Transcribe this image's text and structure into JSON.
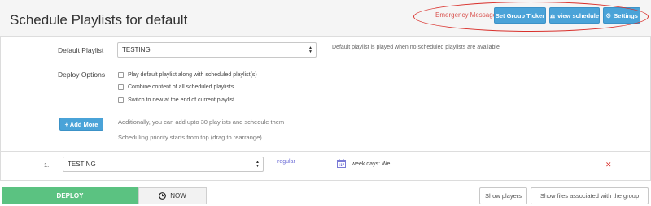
{
  "header": {
    "title": "Schedule Playlists for default",
    "emergency_message": "Emergency Message",
    "set_group_ticker": "Set Group Ticker",
    "view_schedule": "view schedule",
    "settings": "Settings"
  },
  "form": {
    "default_playlist_label": "Default Playlist",
    "default_playlist_value": "TESTING",
    "default_playlist_hint": "Default playlist is played when no scheduled playlists are available",
    "deploy_options_label": "Deploy Options",
    "options": [
      {
        "label": "Play default playlist along with scheduled playlist(s)",
        "checked": false
      },
      {
        "label": "Combine content of all scheduled playlists",
        "checked": false
      },
      {
        "label": "Switch to new at the end of current playlist",
        "checked": false
      }
    ],
    "add_more": "+ Add More",
    "info_line_1": "Additionally, you can add upto 30 playlists and schedule them",
    "info_line_2": "Scheduling priority starts from top (drag to rearrange)"
  },
  "schedule_rows": [
    {
      "number": "1.",
      "playlist": "TESTING",
      "type": "regular",
      "days": "week days: We"
    }
  ],
  "footer": {
    "deploy": "DEPLOY",
    "now": "NOW",
    "show_players": "Show players",
    "show_files": "Show files associated with the group"
  },
  "colors": {
    "accent_blue": "#4aa3d8",
    "deploy_green": "#5bc281",
    "alert_red": "#d9302b"
  }
}
